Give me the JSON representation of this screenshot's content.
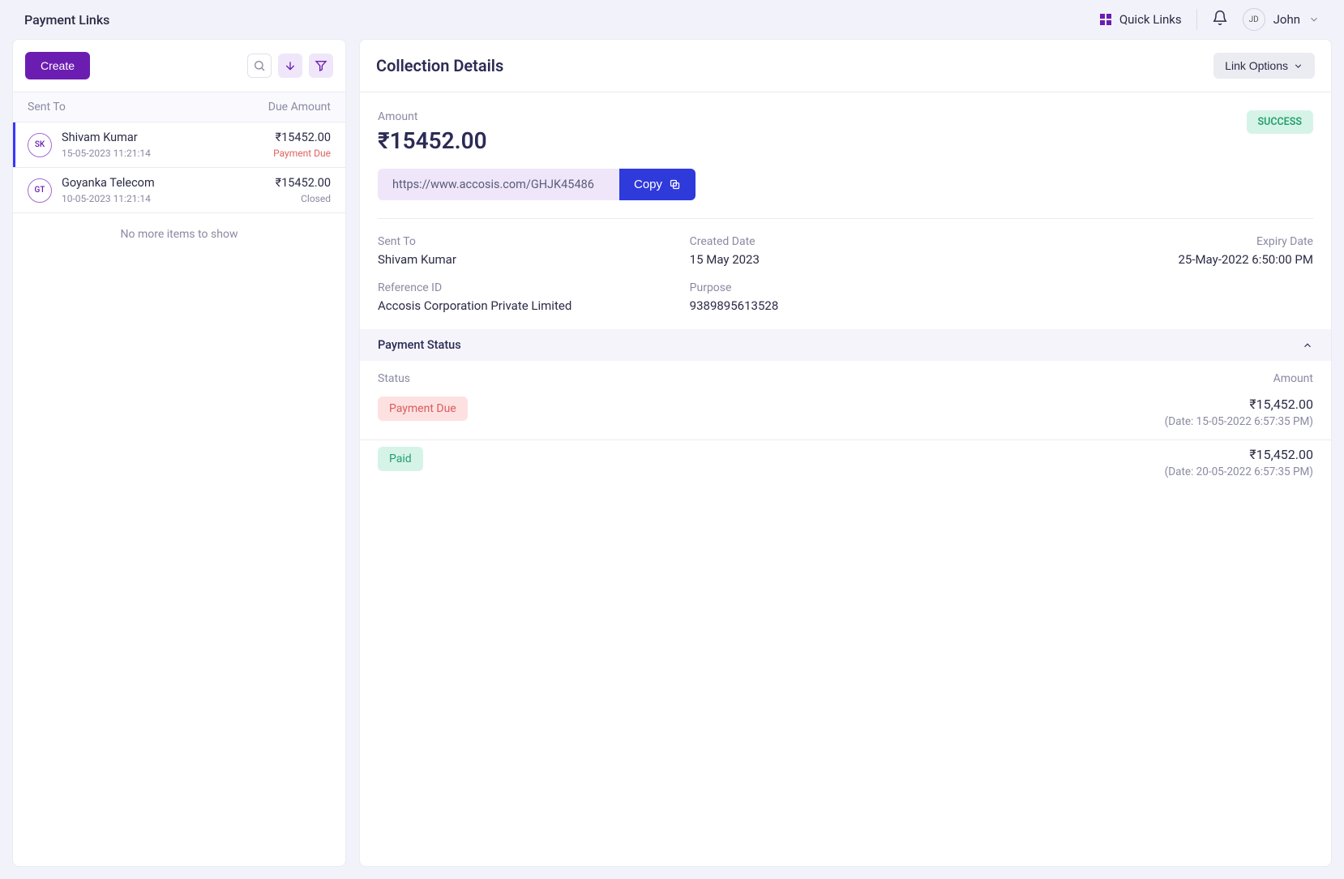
{
  "header": {
    "page_title": "Payment Links",
    "quick_links": "Quick Links",
    "user_initials": "JD",
    "user_name": "John"
  },
  "left": {
    "create": "Create",
    "col_sent": "Sent To",
    "col_due": "Due Amount",
    "no_more": "No more items to show",
    "items": [
      {
        "initials": "SK",
        "name": "Shivam Kumar",
        "date": "15-05-2023 11:21:14",
        "amount": "₹15452.00",
        "status": "Payment Due",
        "status_class": "due",
        "active": true
      },
      {
        "initials": "GT",
        "name": "Goyanka Telecom",
        "date": "10-05-2023 11:21:14",
        "amount": "₹15452.00",
        "status": "Closed",
        "status_class": "closed",
        "active": false
      }
    ]
  },
  "details": {
    "title": "Collection Details",
    "link_options": "Link Options",
    "amount_label": "Amount",
    "amount": "₹15452.00",
    "success": "SUCCESS",
    "link": "https://www.accosis.com/GHJK45486",
    "copy": "Copy",
    "sent_to_lbl": "Sent To",
    "sent_to": "Shivam Kumar",
    "created_lbl": "Created Date",
    "created": "15 May 2023",
    "expiry_lbl": "Expiry Date",
    "expiry": "25-May-2022 6:50:00 PM",
    "ref_lbl": "Reference ID",
    "ref": "Accosis Corporation Private Limited",
    "purpose_lbl": "Purpose",
    "purpose": "9389895613528",
    "ps_header": "Payment Status",
    "ps_col_status": "Status",
    "ps_col_amount": "Amount",
    "ps_rows": [
      {
        "status": "Payment Due",
        "class": "due",
        "amount": "₹15,452.00",
        "date": "(Date: 15-05-2022 6:57:35 PM)"
      },
      {
        "status": "Paid",
        "class": "paid",
        "amount": "₹15,452.00",
        "date": "(Date: 20-05-2022 6:57:35 PM)"
      }
    ]
  }
}
